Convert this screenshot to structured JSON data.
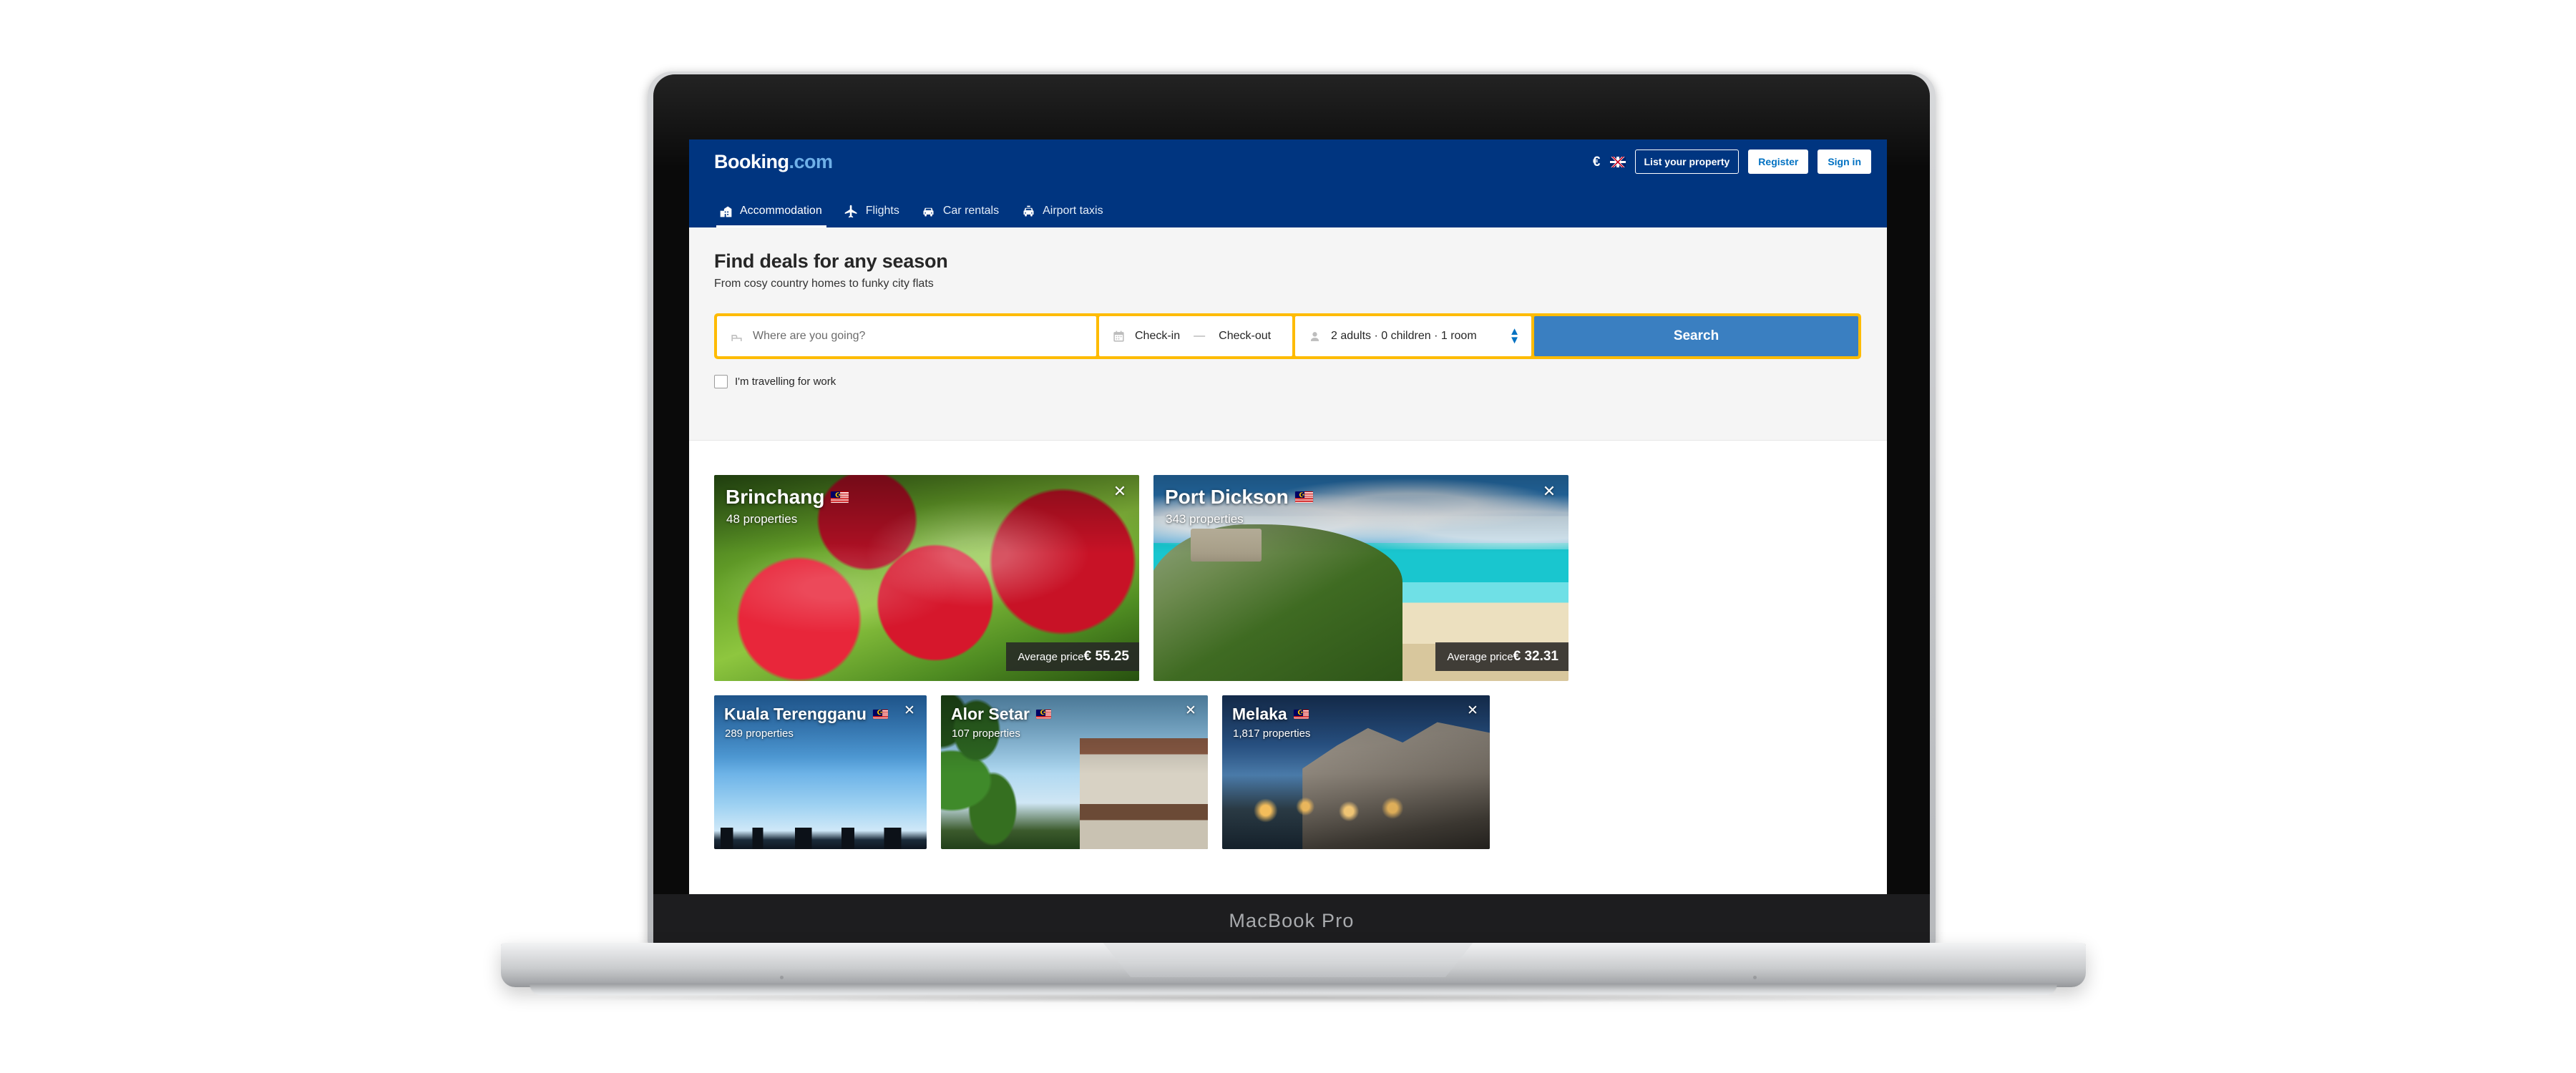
{
  "device": {
    "label": "MacBook Pro"
  },
  "header": {
    "logo_main": "Booking",
    "logo_suffix": ".com",
    "currency_symbol": "€",
    "language_icon": "uk-flag-icon",
    "list_property_label": "List your property",
    "register_label": "Register",
    "signin_label": "Sign in",
    "nav": [
      {
        "label": "Accommodation",
        "icon": "building-icon",
        "active": true
      },
      {
        "label": "Flights",
        "icon": "plane-icon",
        "active": false
      },
      {
        "label": "Car rentals",
        "icon": "car-icon",
        "active": false
      },
      {
        "label": "Airport taxis",
        "icon": "taxi-icon",
        "active": false
      }
    ]
  },
  "hero": {
    "title": "Find deals for any season",
    "subtitle": "From cosy country homes to funky city flats",
    "destination_placeholder": "Where are you going?",
    "destination_value": "",
    "checkin_label": "Check-in",
    "date_separator": "—",
    "checkout_label": "Check-out",
    "occupancy_value": "2 adults · 0 children · 1 room",
    "search_label": "Search",
    "work_checkbox_label": "I'm travelling for work",
    "work_checked": false
  },
  "cards": {
    "price_prefix": "Average price",
    "row1": [
      {
        "name": "Brinchang",
        "flag": "malaysia-flag-icon",
        "properties": "48 properties",
        "price": "€ 55.25",
        "has_price": true,
        "close_icon": "close-icon"
      },
      {
        "name": "Port Dickson",
        "flag": "malaysia-flag-icon",
        "properties": "343 properties",
        "price": "€ 32.31",
        "has_price": true,
        "close_icon": "close-icon"
      }
    ],
    "row2": [
      {
        "name": "Kuala Terengganu",
        "flag": "malaysia-flag-icon",
        "properties": "289 properties",
        "close_icon": "close-icon"
      },
      {
        "name": "Alor Setar",
        "flag": "malaysia-flag-icon",
        "properties": "107 properties",
        "close_icon": "close-icon"
      },
      {
        "name": "Melaka",
        "flag": "malaysia-flag-icon",
        "properties": "1,817 properties",
        "close_icon": "close-icon"
      }
    ]
  },
  "colors": {
    "brand_blue": "#003580",
    "accent_yellow": "#febb02",
    "search_blue": "#3a7fc1",
    "link_blue": "#0071c2"
  }
}
